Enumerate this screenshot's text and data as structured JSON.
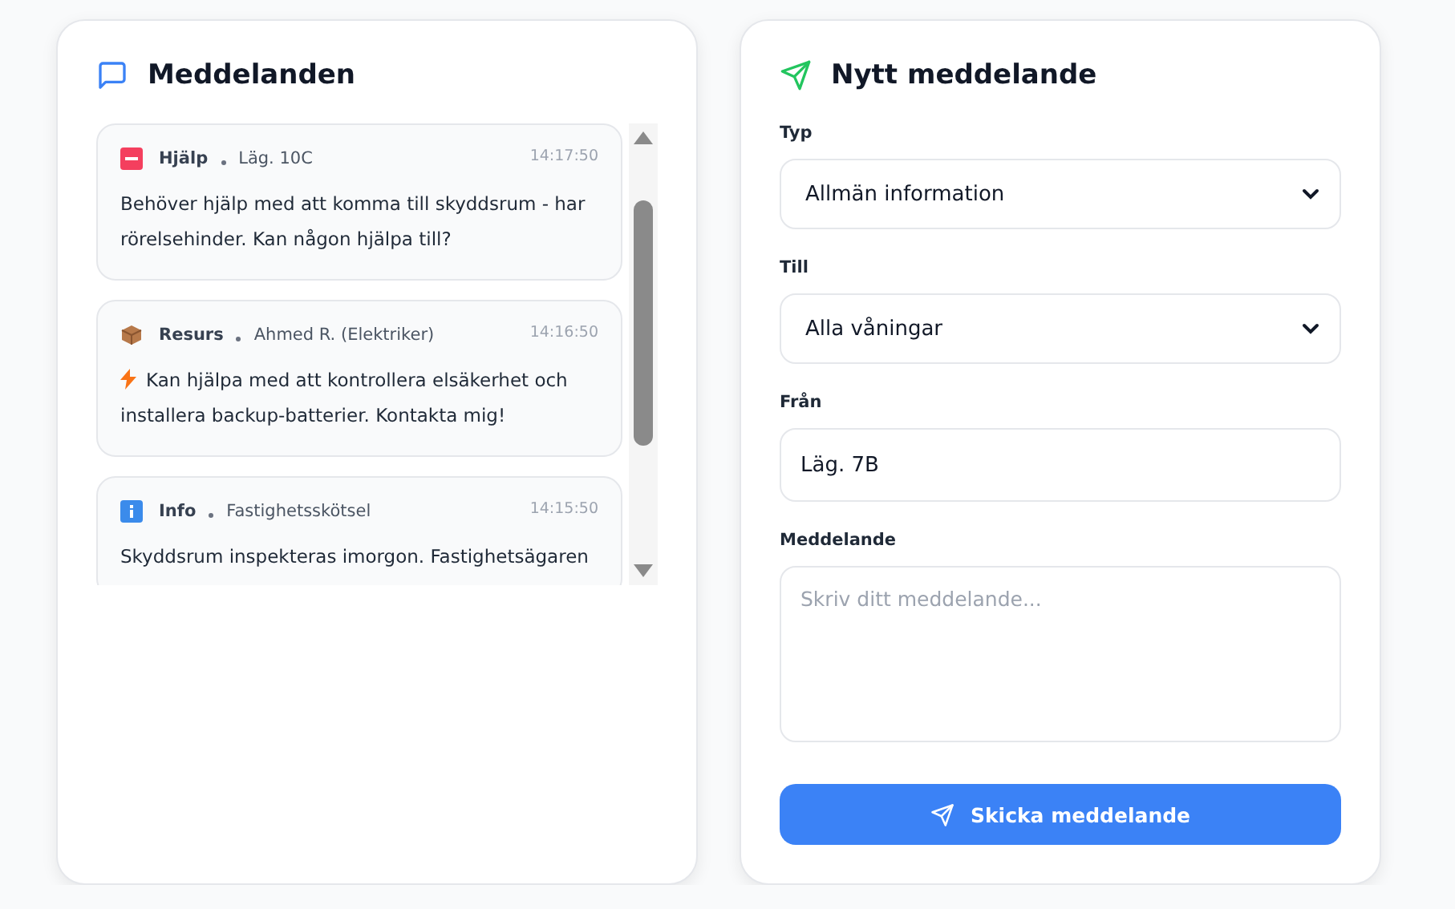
{
  "messages_panel": {
    "title": "Meddelanden",
    "messages": [
      {
        "kind": "help",
        "category": "Hjälp",
        "sender": "Läg. 10C",
        "time": "14:17:50",
        "bolt": false,
        "text": "Behöver hjälp med att komma till skyddsrum - har rörelsehinder. Kan någon hjälpa till?"
      },
      {
        "kind": "resource",
        "category": "Resurs",
        "sender": "Ahmed R. (Elektriker)",
        "time": "14:16:50",
        "bolt": true,
        "text": "Kan hjälpa med att kontrollera elsäkerhet och installera backup-batterier. Kontakta mig!"
      },
      {
        "kind": "info",
        "category": "Info",
        "sender": "Fastighetsskötsel",
        "time": "14:15:50",
        "bolt": false,
        "text": "Skyddsrum inspekteras imorgon. Fastighetsägaren"
      }
    ]
  },
  "form": {
    "title": "Nytt meddelande",
    "fields": [
      {
        "kind": "select",
        "label": "Typ",
        "value": "Allmän information"
      },
      {
        "kind": "select",
        "label": "Till",
        "value": "Alla våningar"
      },
      {
        "kind": "input",
        "label": "Från",
        "value": "Läg. 7B"
      },
      {
        "kind": "textarea",
        "label": "Meddelande",
        "placeholder": "Skriv ditt meddelande..."
      }
    ],
    "submit": "Skicka meddelande"
  }
}
